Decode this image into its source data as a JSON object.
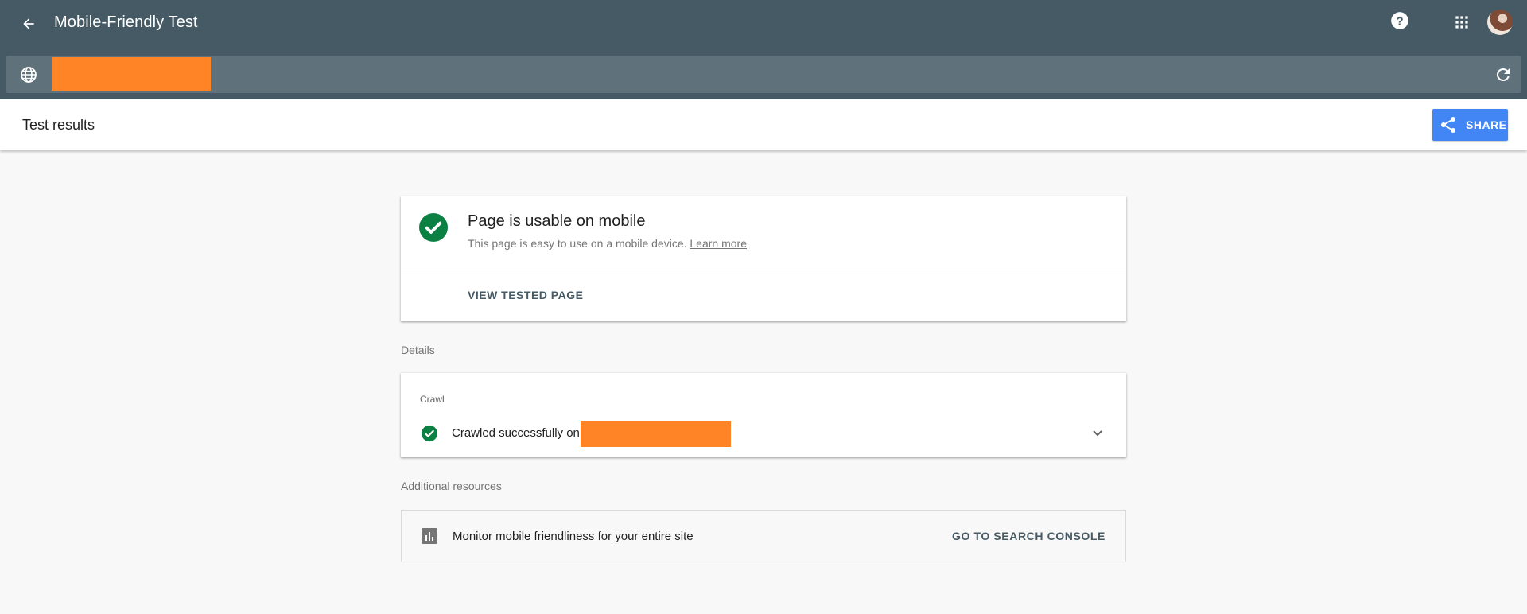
{
  "header": {
    "title": "Mobile-Friendly Test",
    "back_icon": "arrow-back-icon",
    "help_icon": "help-icon",
    "apps_icon": "apps-grid-icon"
  },
  "url_bar": {
    "value": "",
    "redacted": true,
    "globe_icon": "globe-icon",
    "refresh_icon": "refresh-icon"
  },
  "subheader": {
    "title": "Test results",
    "share_label": "SHARE",
    "share_icon": "share-icon"
  },
  "result": {
    "title": "Page is usable on mobile",
    "description": "This page is easy to use on a mobile device.",
    "learn_more": "Learn more",
    "view_button": "VIEW TESTED PAGE",
    "status_icon": "check-circle-icon"
  },
  "details": {
    "section_label": "Details",
    "crawl_label": "Crawl",
    "crawl_text": "Crawled successfully on",
    "crawl_date_redacted": true,
    "expand_icon": "chevron-down-icon"
  },
  "resources": {
    "section_label": "Additional resources",
    "text": "Monitor mobile friendliness for your entire site",
    "button": "GO TO SEARCH CONSOLE",
    "icon": "bar-chart-icon"
  },
  "colors": {
    "appbar": "#455a64",
    "urlbar": "#5f717b",
    "accent": "#4285f4",
    "success": "#0b8043",
    "redaction": "#ff8426"
  }
}
